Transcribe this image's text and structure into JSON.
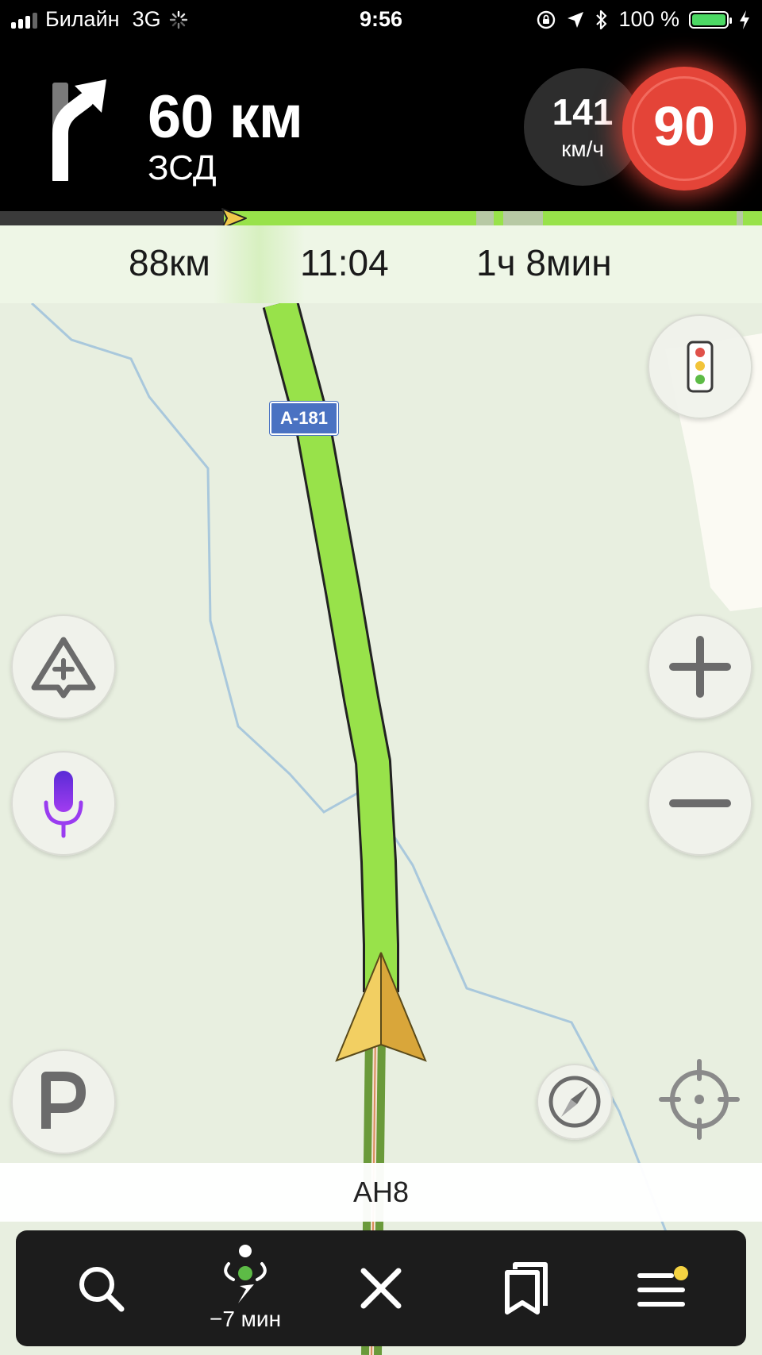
{
  "status_bar": {
    "carrier": "Билайн",
    "network": "3G",
    "time": "9:56",
    "battery": "100 %"
  },
  "maneuver": {
    "distance": "60 км",
    "road_name": "ЗСД",
    "turn_icon": "turn-slight-right-icon"
  },
  "speed": {
    "current": "141",
    "unit": "км/ч",
    "limit": "90"
  },
  "route_progress": 0.3,
  "trip": {
    "distance_left": "88км",
    "arrival_time": "11:04",
    "time_left": "1ч 8мин"
  },
  "map": {
    "road_shield": "А-181",
    "current_street": "АН8",
    "route_color": "#98e24a"
  },
  "toolbar": {
    "overview_label": "−7 мин",
    "accent_color": "#f5d342"
  }
}
